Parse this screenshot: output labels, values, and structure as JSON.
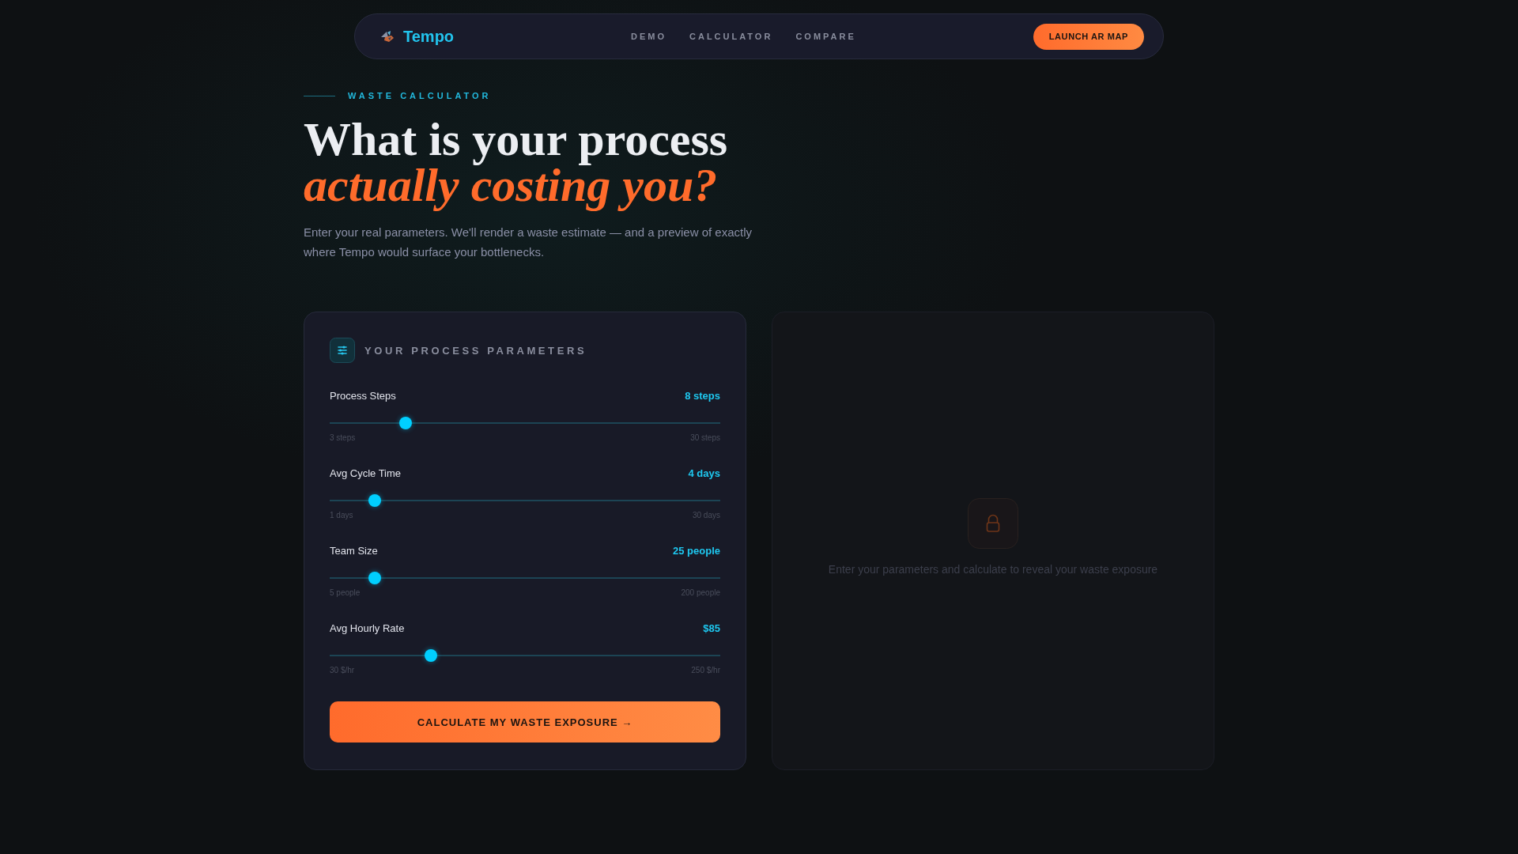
{
  "nav": {
    "brand": "Tempo",
    "links": [
      "DEMO",
      "CALCULATOR",
      "COMPARE"
    ],
    "cta": "LAUNCH AR MAP"
  },
  "hero": {
    "eyebrow": "WASTE CALCULATOR",
    "title": "What is your process",
    "title_accent": "actually costing you?",
    "intro": "Enter your real parameters. We'll render a waste estimate — and a preview of exactly where Tempo would surface your bottlenecks."
  },
  "parameters_panel": {
    "title": "YOUR PROCESS PARAMETERS",
    "sliders": [
      {
        "label": "Process Steps",
        "reading": "8 steps",
        "level": 0.185,
        "min": "3 steps",
        "max": "30 steps"
      },
      {
        "label": "Avg Cycle Time",
        "reading": "4 days",
        "level": 0.103,
        "min": "1 days",
        "max": "30 days"
      },
      {
        "label": "Team Size",
        "reading": "25 people",
        "level": 0.103,
        "min": "5 people",
        "max": "200 people"
      },
      {
        "label": "Avg Hourly Rate",
        "reading": "$85",
        "level": 0.25,
        "min": "30 $/hr",
        "max": "250 $/hr"
      }
    ],
    "button": "CALCULATE MY WASTE EXPOSURE →"
  },
  "results_panel": {
    "locked": true,
    "message": "Enter your parameters and calculate to reveal your waste exposure"
  }
}
